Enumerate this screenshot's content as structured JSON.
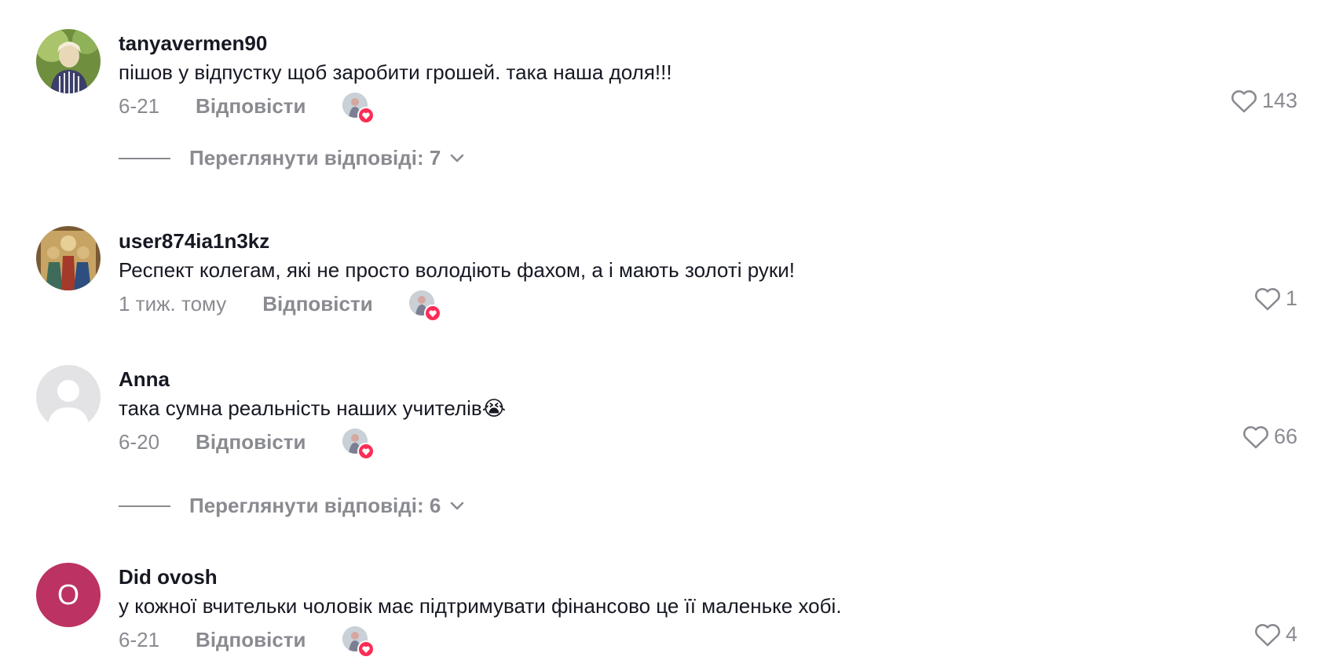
{
  "comments": [
    {
      "username": "tanyavermen90",
      "text": "пішов у відпустку щоб заробити грошей. така наша доля!!!",
      "date": "6-21",
      "reply_label": "Відповісти",
      "likes": "143",
      "avatar_icon": "photo-avatar-woman",
      "view_replies": "Переглянути відповіді: 7"
    },
    {
      "username": "user874ia1n3kz",
      "text": "Респект колегам, які не просто володіють фахом, а і мають золоті руки!",
      "date": "1 тиж. тому",
      "reply_label": "Відповісти",
      "likes": "1",
      "avatar_icon": "photo-avatar-icon-painting"
    },
    {
      "username": "Anna",
      "text": "така сумна реальність наших учителів😭",
      "date": "6-20",
      "reply_label": "Відповісти",
      "likes": "66",
      "avatar_icon": "default-avatar",
      "view_replies": "Переглянути відповіді: 6"
    },
    {
      "username": "Did ovosh",
      "text": "у кожної вчительки чоловік має підтримувати фінансово це її маленьке хобі.",
      "date": "6-21",
      "reply_label": "Відповісти",
      "likes": "4",
      "avatar_icon": "letter-avatar",
      "avatar_letter": "O"
    }
  ],
  "colors": {
    "text_primary": "#161823",
    "text_secondary": "#8a8b91",
    "accent_red": "#fe2c55",
    "letter_avatar_bg": "#bb3263"
  }
}
